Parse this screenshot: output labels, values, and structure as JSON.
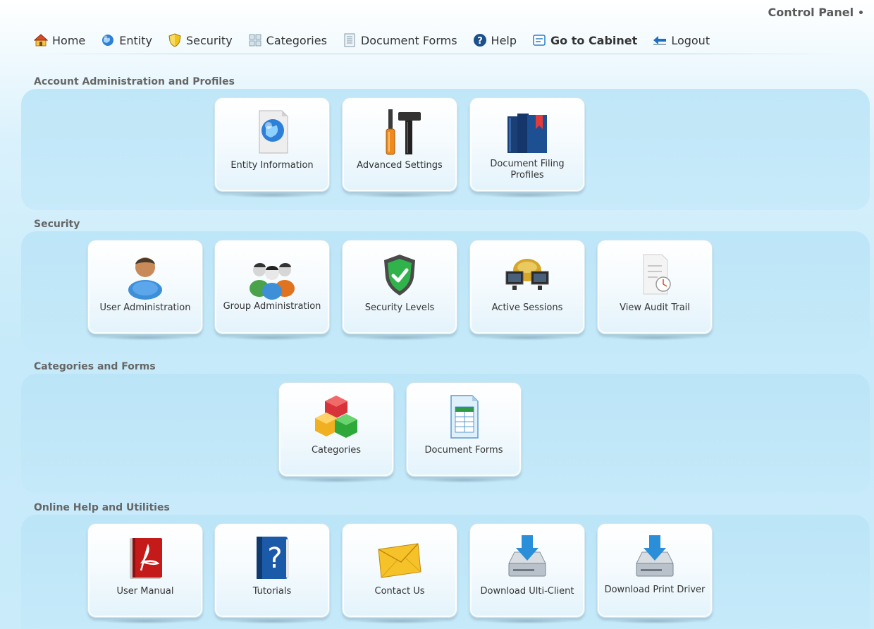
{
  "header": {
    "title": "Control Panel",
    "title_dot": "•"
  },
  "nav": {
    "home": "Home",
    "entity": "Entity",
    "security": "Security",
    "categories": "Categories",
    "document_forms": "Document Forms",
    "help": "Help",
    "go_to_cabinet": "Go to Cabinet",
    "logout": "Logout"
  },
  "sections": {
    "account": {
      "label": "Account Administration and Profiles",
      "tiles": {
        "entity_information": "Entity Information",
        "advanced_settings": "Advanced Settings",
        "document_filing_profiles": "Document Filing Profiles"
      }
    },
    "security": {
      "label": "Security",
      "tiles": {
        "user_administration": "User Administration",
        "group_administration": "Group Administration",
        "security_levels": "Security Levels",
        "active_sessions": "Active Sessions",
        "view_audit_trail": "View Audit Trail"
      }
    },
    "categories_forms": {
      "label": "Categories and Forms",
      "tiles": {
        "categories": "Categories",
        "document_forms": "Document Forms"
      }
    },
    "help_utilities": {
      "label": "Online Help and Utilities",
      "tiles": {
        "user_manual": "User Manual",
        "tutorials": "Tutorials",
        "contact_us": "Contact Us",
        "download_ulti_client": "Download Ulti-Client",
        "download_print_driver": "Download Print Driver"
      }
    }
  },
  "colors": {
    "band": "#c0e7f8",
    "text": "#333333",
    "section_label": "#666666"
  }
}
